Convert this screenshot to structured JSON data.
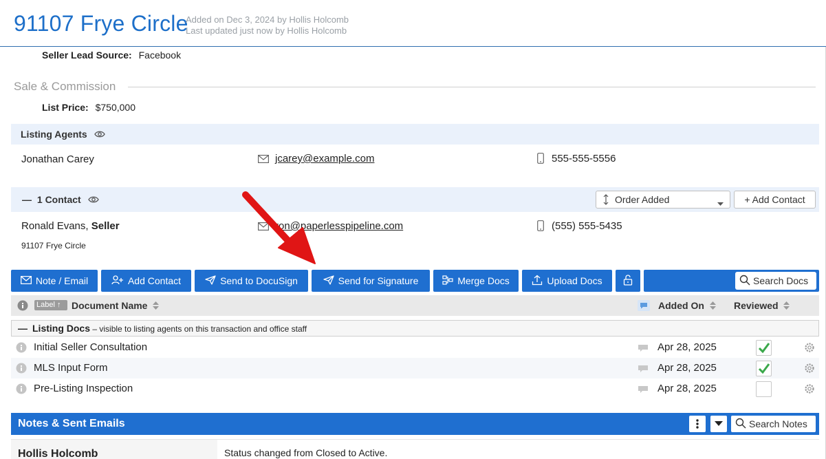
{
  "header": {
    "title": "91107 Frye Circle",
    "added_on": "Added on Dec 3, 2024 by Hollis Holcomb",
    "updated": "Last updated just now by Hollis Holcomb"
  },
  "seller_lead": {
    "label": "Seller Lead Source:",
    "value": "Facebook"
  },
  "sale_commission": {
    "section_title": "Sale & Commission",
    "list_price_label": "List Price:",
    "list_price_value": "$750,000"
  },
  "listing_agents": {
    "title": "Listing Agents",
    "agent": {
      "name": "Jonathan Carey",
      "email": "jcarey@example.com",
      "phone": "555-555-5556"
    }
  },
  "contacts": {
    "title": "1 Contact",
    "collapse_symbol": "—",
    "order_select": "Order Added",
    "add_button": "+ Add Contact",
    "contact": {
      "name": "Ronald Evans,",
      "role": "Seller",
      "email": "ron@paperlesspipeline.com",
      "phone": "(555) 555-5435",
      "address": "91107 Frye Circle"
    }
  },
  "toolbar": {
    "note_email": "Note / Email",
    "add_contact": "Add Contact",
    "send_docusign": "Send to DocuSign",
    "send_signature": "Send for Signature",
    "merge_docs": "Merge Docs",
    "upload_docs": "Upload Docs",
    "search_docs": "Search Docs"
  },
  "doc_table": {
    "label_chip": "Label ↑",
    "col_name": "Document Name",
    "col_added": "Added On",
    "col_reviewed": "Reviewed",
    "group": {
      "collapse_symbol": "—",
      "name": "Listing Docs",
      "desc": " – visible to listing agents on this transaction and office staff"
    },
    "rows": [
      {
        "name": "Initial Seller Consultation",
        "date": "Apr 28, 2025",
        "reviewed": true
      },
      {
        "name": "MLS Input Form",
        "date": "Apr 28, 2025",
        "reviewed": true
      },
      {
        "name": "Pre-Listing Inspection",
        "date": "Apr 28, 2025",
        "reviewed": false
      }
    ]
  },
  "notes": {
    "title": "Notes & Sent Emails",
    "search": "Search Notes",
    "entry": {
      "author": "Hollis Holcomb",
      "text": "Status changed from Closed to Active."
    }
  },
  "colors": {
    "brand_blue": "#1f6fd0",
    "title_blue": "#1d6fc9",
    "check_green": "#3aa84a",
    "arrow_red": "#e01515"
  },
  "icons": [
    "eye-icon",
    "mail-icon",
    "phone-icon",
    "sort-icon",
    "chevron-down-icon",
    "add-user-icon",
    "send-icon",
    "merge-icon",
    "upload-icon",
    "unlock-icon",
    "search-icon",
    "info-icon",
    "comment-icon",
    "gear-icon",
    "check-icon",
    "kebab-icon",
    "callout-arrow"
  ]
}
